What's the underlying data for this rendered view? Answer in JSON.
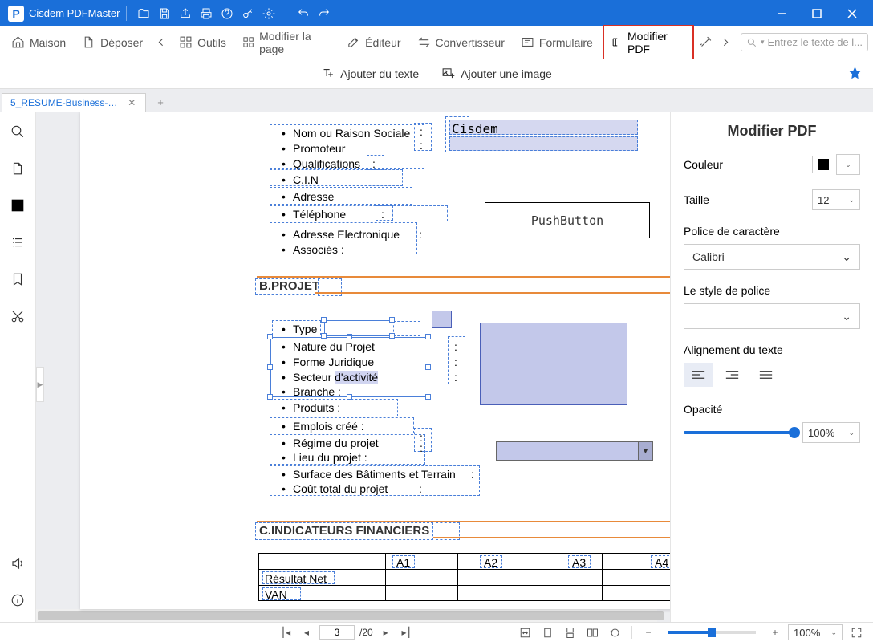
{
  "app": {
    "title": "Cisdem PDFMaster"
  },
  "toolbar": {
    "home": "Maison",
    "file": "Déposer",
    "tools": "Outils",
    "modify_page": "Modifier la page",
    "editor": "Éditeur",
    "converter": "Convertisseur",
    "form": "Formulaire",
    "modify_pdf": "Modifier PDF",
    "search_placeholder": "Entrez le texte de l..."
  },
  "subtoolbar": {
    "add_text": "Ajouter du texte",
    "add_image": "Ajouter une image"
  },
  "tab": {
    "name": "5_RESUME-Business-... *"
  },
  "doc": {
    "cisdem": "Cisdem",
    "a": {
      "l1": "Nom ou Raison Sociale",
      "l2": "Promoteur",
      "l3": "Qualifications",
      "l3c": ":",
      "l4": "C.I.N",
      "l5": "Adresse",
      "l6": "Téléphone",
      "l6c": ":",
      "l7": "Adresse Electronique",
      "l7c": ":",
      "l8": "Associés  :"
    },
    "pushbutton": "PushButton",
    "b_head": "B.PROJET",
    "b": {
      "l1": "Type",
      "l2": "Nature du Projet",
      "l3": "Forme Juridique",
      "l4_a": "Secteur ",
      "l4_b": "d'activité",
      "l5": "Branche  :",
      "l6": "Produits   :",
      "l7": "Emplois créé  :",
      "l8": "Régime du projet",
      "l9": "Lieu du projet  :",
      "l10": "Surface des Bâtiments et Terrain",
      "l10c": ":",
      "l11": "Coût total du projet",
      "l11c": ":",
      "col1": ":",
      "col2": ":",
      "col3": ":"
    },
    "c_head": "C.INDICATEURS FINANCIERS",
    "table": {
      "a1": "A1",
      "a2": "A2",
      "a3": "A3",
      "a4": "A4",
      "r1": "Résultat Net",
      "r2": "VAN"
    }
  },
  "side": {
    "title": "Modifier PDF",
    "color": "Couleur",
    "size": "Taille",
    "size_val": "12",
    "font": "Police de caractère",
    "font_val": "Calibri",
    "style": "Le style de police",
    "align": "Alignement du texte",
    "opacity": "Opacité",
    "opacity_val": "100%"
  },
  "status": {
    "page": "3",
    "total": "/20",
    "zoom": "100%"
  }
}
